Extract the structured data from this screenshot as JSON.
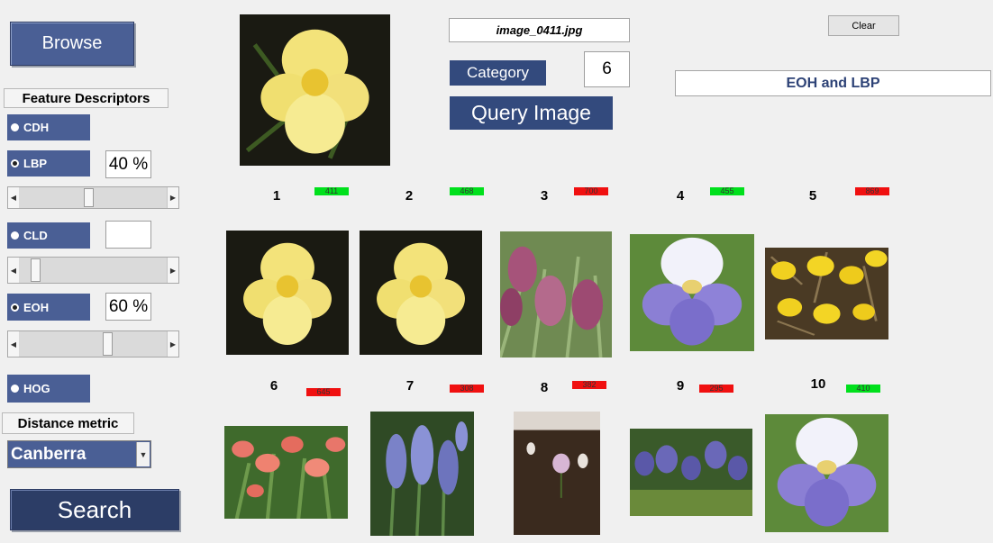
{
  "left_panel": {
    "browse_label": "Browse",
    "feature_descriptors_label": "Feature Descriptors",
    "descriptors": [
      {
        "label": "CDH",
        "selected": false
      },
      {
        "label": "LBP",
        "selected": true,
        "weight": "40 %",
        "slider_fraction": 0.4
      },
      {
        "label": "CLD",
        "selected": false,
        "weight": "",
        "slider_fraction": 0.0
      },
      {
        "label": "EOH",
        "selected": true,
        "weight": "60 %",
        "slider_fraction": 0.6
      },
      {
        "label": "HOG",
        "selected": false
      }
    ],
    "distance_metric_label": "Distance metric",
    "distance_metric_value": "Canberra",
    "search_label": "Search"
  },
  "query": {
    "filename": "image_0411.jpg",
    "category_label": "Category",
    "category_value": "6",
    "query_button_label": "Query Image",
    "clear_label": "Clear",
    "method_label": "EOH and LBP",
    "image_icon": "yellow-iris-image"
  },
  "results": [
    {
      "rank": "1",
      "id": "411",
      "status": "match",
      "image": "yellow-iris"
    },
    {
      "rank": "2",
      "id": "468",
      "status": "match",
      "image": "yellow-iris"
    },
    {
      "rank": "3",
      "id": "700",
      "status": "mismatch",
      "image": "fritillaria"
    },
    {
      "rank": "4",
      "id": "455",
      "status": "match",
      "image": "white-purple-iris"
    },
    {
      "rank": "5",
      "id": "869",
      "status": "mismatch",
      "image": "coltsfoot"
    },
    {
      "rank": "6",
      "id": "645",
      "status": "mismatch",
      "image": "orange-lilies"
    },
    {
      "rank": "7",
      "id": "308",
      "status": "mismatch",
      "image": "bluebells"
    },
    {
      "rank": "8",
      "id": "382",
      "status": "mismatch",
      "image": "crocus"
    },
    {
      "rank": "9",
      "id": "295",
      "status": "mismatch",
      "image": "bluebells-wide"
    },
    {
      "rank": "10",
      "id": "410",
      "status": "match",
      "image": "white-purple-iris"
    }
  ],
  "colors": {
    "panel_blue": "#4a5f95",
    "match_green": "#00e01c",
    "mismatch_red": "#f01010"
  }
}
